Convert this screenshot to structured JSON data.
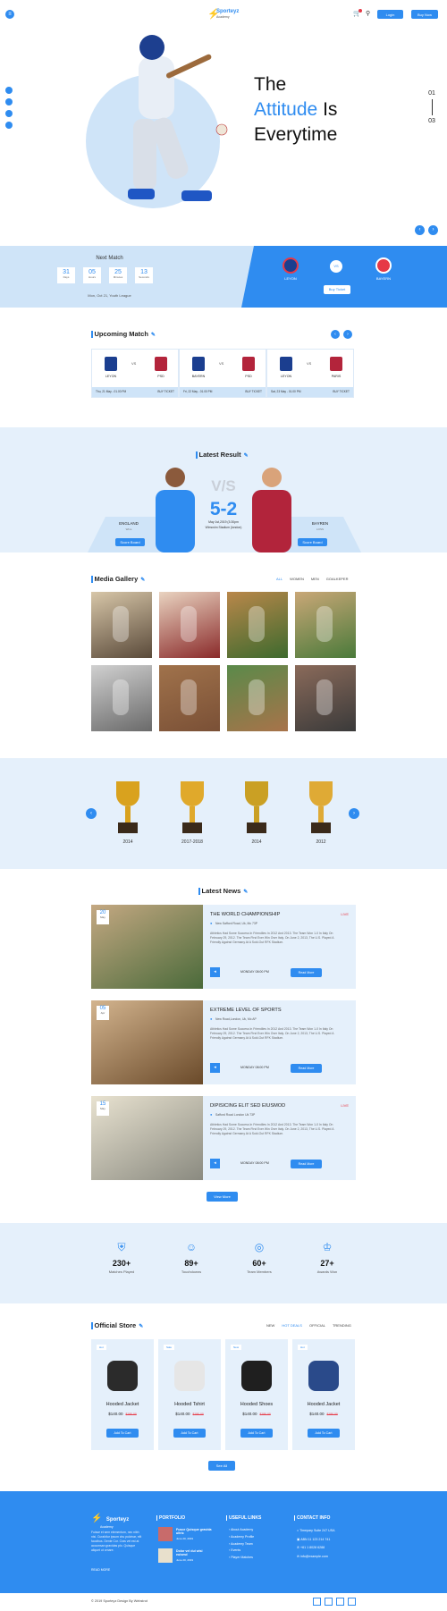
{
  "header": {
    "logo_name": "Sporteyz",
    "logo_sub": "Academy",
    "login": "Login",
    "buy_now": "Buy Now"
  },
  "hero": {
    "line1": "The",
    "line2_blue": "Attitude",
    "line2_rest": "Is",
    "line3": "Everytime",
    "slide_top": "01",
    "slide_bottom": "03"
  },
  "next_match": {
    "title": "Next Match",
    "countdown": [
      {
        "v": "31",
        "l": "Days"
      },
      {
        "v": "05",
        "l": "Hours"
      },
      {
        "v": "25",
        "l": "Minutes"
      },
      {
        "v": "13",
        "l": "Seconds"
      }
    ],
    "info": "Mon, Oct 21, Youth League",
    "team1": "LEYON",
    "vs": "VS",
    "team2": "BAYERN",
    "buy": "Buy Ticket"
  },
  "upcoming": {
    "title": "Upcoming Match",
    "matches": [
      {
        "t1": "LEYON",
        "t2": "PSD",
        "date": "Thu, 21 May - 01.00 PM",
        "buy": "BUY TICKET"
      },
      {
        "t1": "BAYERN",
        "t2": "PSD",
        "date": "Fri, 22 May - 01.00 PM",
        "buy": "BUY TICKET"
      },
      {
        "t1": "LEYON",
        "t2": "PARIS",
        "date": "Sat, 23 May - 01.00 PM",
        "buy": "BUY TICKET"
      }
    ]
  },
  "result": {
    "title": "Latest Result",
    "vs": "V/S",
    "score": "5-2",
    "date": "May 1st,2019 (3:30pm",
    "venue": "Wimcshn Stadium (london)",
    "left_team": "ENGLAND",
    "left_sub": "Wins",
    "right_team": "BAYREN",
    "right_sub": "LOSS",
    "left_btn": "Score Board",
    "right_btn": "Score Board"
  },
  "gallery": {
    "title": "Media Gallery",
    "filters": [
      "ALL",
      "WOMEN",
      "MEN",
      "GOALKEPER"
    ]
  },
  "trophies": [
    {
      "year": "2014"
    },
    {
      "year": "2017-2018"
    },
    {
      "year": "2014"
    },
    {
      "year": "2012"
    }
  ],
  "news": {
    "title": "Latest News",
    "more": "View More",
    "items": [
      {
        "day": "20",
        "mon": "May",
        "title": "THE WORLD CHAMPIONSHIP",
        "live": "LIVE",
        "loc": "New Safford Road, Uk, Mc 73P",
        "body": "Athletics Had Some Success In Friendlies In 2012 And 2013. The Team Won 1-0 In Italy On February 29, 2012. The Team First Ever Win Over Italy. On June 2, 2013, The U.S. Played A Friendly Against Germany At A Sold-Out RFK Stadium.",
        "time": "MONDAY 08:00 PM",
        "btn": "Read More"
      },
      {
        "day": "05",
        "mon": "Apr",
        "title": "EXTREME LEVEL OF SPORTS",
        "live": "",
        "loc": "New Road,London, Uk, Mc AP",
        "body": "Athletics Had Some Success In Friendlies In 2012 And 2013. The Team Won 1-0 In Italy On February 29, 2012. The Team First Ever Win Over Italy. On June 2, 2013, The U.S. Played A Friendly Against Germany At A Sold-Out RFK Stadium.",
        "time": "MONDAY 08:00 PM",
        "btn": "Read More"
      },
      {
        "day": "15",
        "mon": "May",
        "title": "DIPISICING ELIT SED EIUSMOD",
        "live": "LIVE",
        "loc": "Safford Road London Uk 73P",
        "body": "Athletics Had Some Success In Friendlies In 2012 And 2013. The Team Won 1-0 In Italy On February 29, 2012. The Team First Ever Win Over Italy. On June 2, 2013, The U.S. Played A Friendly Against Germany At A Sold-Out RFK Stadium.",
        "time": "MONDAY 08:00 PM",
        "btn": "Read More"
      }
    ]
  },
  "stats": [
    {
      "v": "230+",
      "l": "Matches Played"
    },
    {
      "v": "89+",
      "l": "Touchdowns"
    },
    {
      "v": "60+",
      "l": "Team Members"
    },
    {
      "v": "27+",
      "l": "Awards Won"
    }
  ],
  "store": {
    "title": "Official Store",
    "filters": [
      "NEW",
      "HOT DEALS",
      "OFFICIAL",
      "TRENDING"
    ],
    "see_all": "See All",
    "products": [
      {
        "badge": "Hot",
        "name": "Hooded Jacket",
        "price": "$140.00",
        "old": "$180.00",
        "btn": "Add To Cart"
      },
      {
        "badge": "Sale",
        "name": "Hooded Tshirt",
        "price": "$140.00",
        "old": "$180.00",
        "btn": "Add To Cart"
      },
      {
        "badge": "New",
        "name": "Hooded Shoes",
        "price": "$140.00",
        "old": "$180.00",
        "btn": "Add To Cart"
      },
      {
        "badge": "Hot",
        "name": "Hooded Jacket",
        "price": "$140.00",
        "old": "$180.00",
        "btn": "Add To Cart"
      }
    ]
  },
  "footer": {
    "logo": "Sporteyz",
    "logo_sub": "Academy",
    "about": "Fuisse et sem elementum, nec nibh nisi. Curabitur ipsum chu pulvinar, elit faucibus. Dente Cor. Cras vel est at accumsan gravidas plo. Quisque aliquet ut ornare.",
    "read_more": "READ MORE",
    "portfolio_title": "PORTFOLIO",
    "posts": [
      {
        "t": "Fusce Quisque gravida ultric",
        "d": "June 20, 2019"
      },
      {
        "t": "Dolor vel dui wisi euismd",
        "d": "June 20, 2019"
      }
    ],
    "links_title": "USEFUL LINKS",
    "links": [
      "About Academy",
      "Academy Profile",
      "Academy Team",
      "Events",
      "Player Matches"
    ],
    "contact_title": "CONTACT INFO",
    "contacts": [
      "Timepary Suite 247 USA",
      "ABN 11 123 214 741",
      "+61 1 8028 6288",
      "info@example.com"
    ],
    "copyright": "© 2019 Sporteyz Design By Webstrot"
  },
  "colors": {
    "accent": "#2f8cf0",
    "light": "#e9f3fd",
    "footer": "#2f8cf0"
  }
}
